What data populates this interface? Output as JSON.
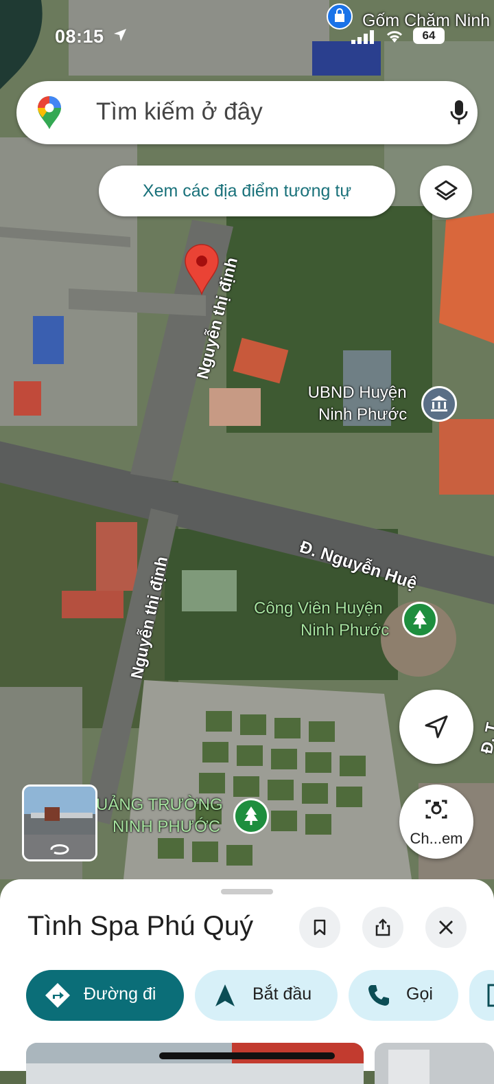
{
  "status_bar": {
    "time": "08:15",
    "battery": "64"
  },
  "top_place": {
    "label": "Gốm Chăm Ninh"
  },
  "search": {
    "placeholder": "Tìm kiếm ở đây"
  },
  "similar_places": {
    "label": "Xem các địa điểm tương tự"
  },
  "roads": {
    "nguyen_thi_dinh_upper": "Nguyễn thị định",
    "nguyen_thi_dinh_lower": "Nguyễn thị định",
    "nguyen_hue": "Đ. Nguyễn Huệ",
    "right_edge": "Đ. T"
  },
  "pois": {
    "ubnd": {
      "line1": "UBND Huyện",
      "line2": "Ninh Phước",
      "color": "#5a6f86"
    },
    "cong_vien": {
      "line1": "Công Viên Huyện",
      "line2": "Ninh Phước",
      "color": "#1e8e3e"
    },
    "quang_truong": {
      "line1": "UẢNG TRƯỜNG",
      "line2": "NINH PHƯỚC",
      "color": "#1e8e3e"
    }
  },
  "lens": {
    "label": "Ch...em"
  },
  "place_sheet": {
    "title": "Tình Spa Phú Quý",
    "actions": {
      "directions": "Đường đi",
      "start": "Bắt đầu",
      "call": "Gọi"
    }
  },
  "colors": {
    "accent": "#0b6e78",
    "pill": "#d7f0f8",
    "pin": "#ea4335",
    "link": "#19717a"
  }
}
